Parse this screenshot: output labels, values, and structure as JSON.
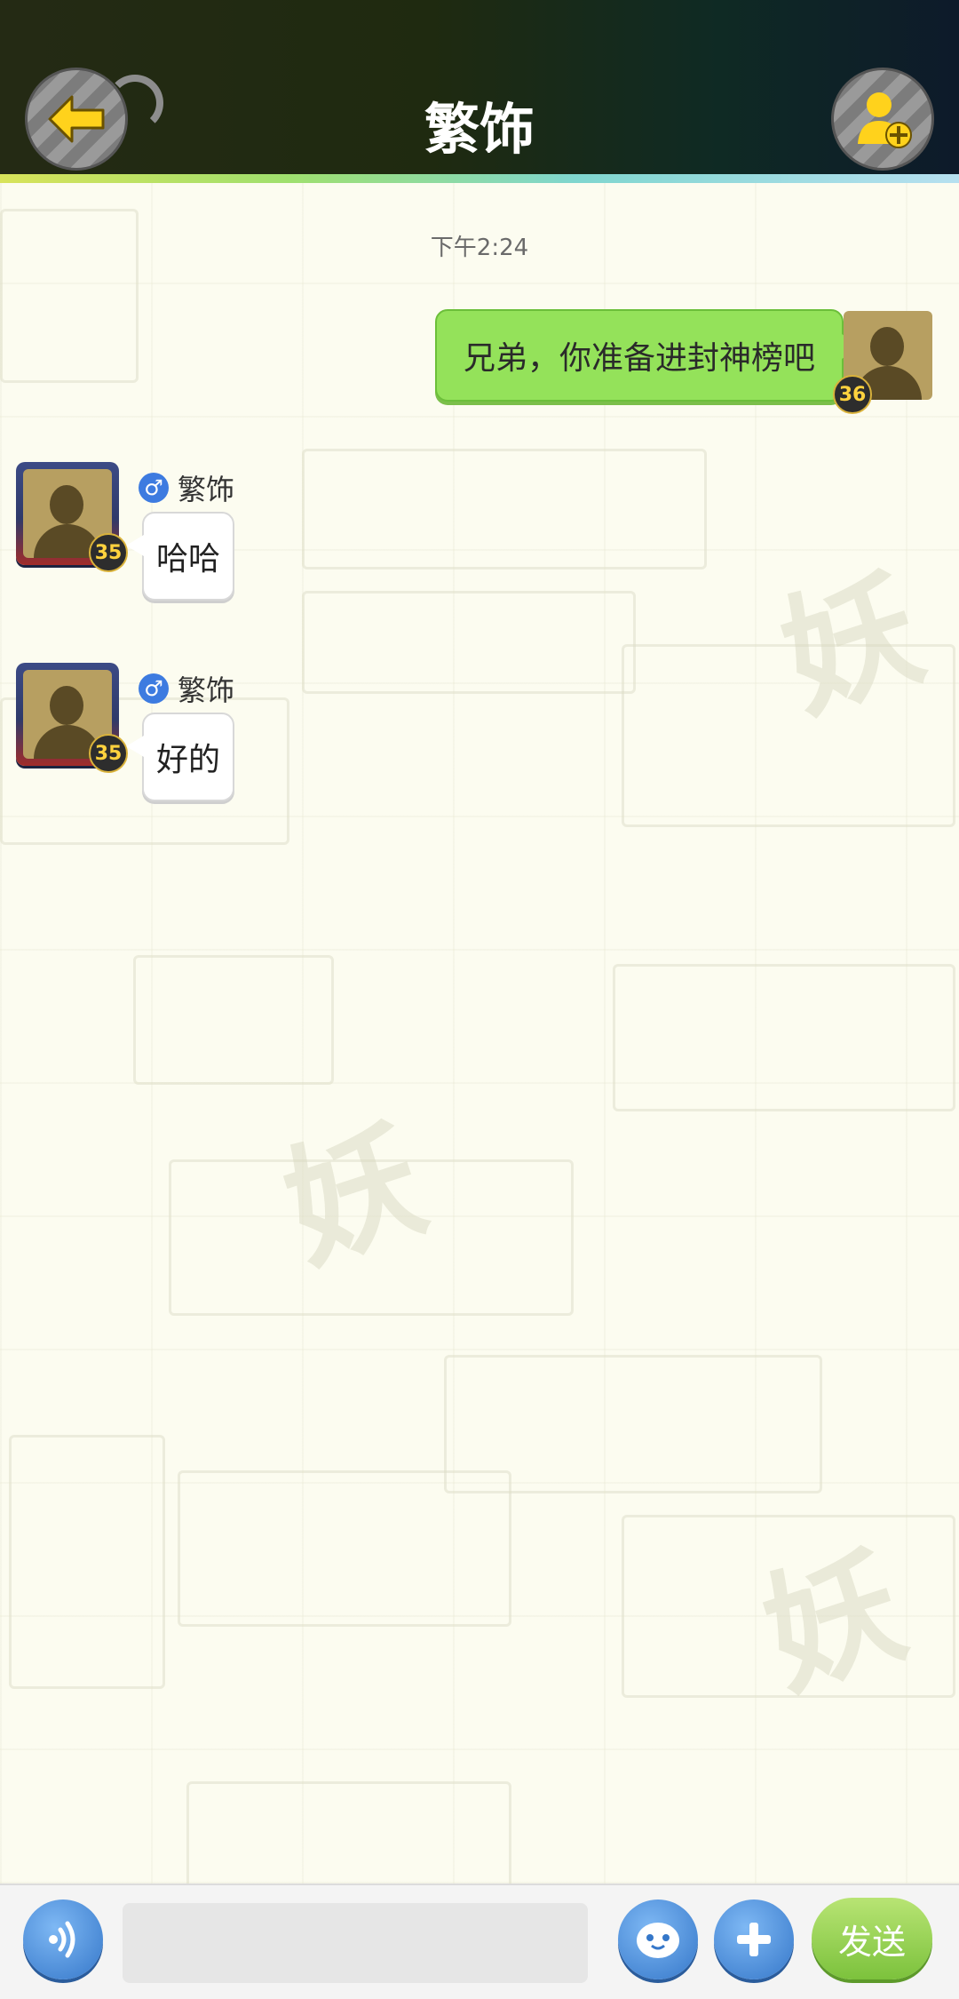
{
  "header": {
    "title": "繁饰",
    "back_icon": "arrow-left-icon",
    "add_friend_icon": "add-friend-icon"
  },
  "chat": {
    "timestamp": "下午2:24",
    "messages": [
      {
        "direction": "sent",
        "text": "兄弟，你准备进封神榜吧",
        "level": "36"
      },
      {
        "direction": "received",
        "sender": "繁饰",
        "gender": "♂",
        "text": "哈哈",
        "level": "35"
      },
      {
        "direction": "received",
        "sender": "繁饰",
        "gender": "♂",
        "text": "好的",
        "level": "35"
      }
    ]
  },
  "input_bar": {
    "voice_icon": "voice-icon",
    "emoji_icon": "emoji-icon",
    "plus_icon": "plus-icon",
    "input_value": "",
    "send_label": "发送"
  },
  "colors": {
    "sent_bubble": "#94e25a",
    "accent_blue": "#3577c9",
    "send_button": "#7cc23c"
  }
}
